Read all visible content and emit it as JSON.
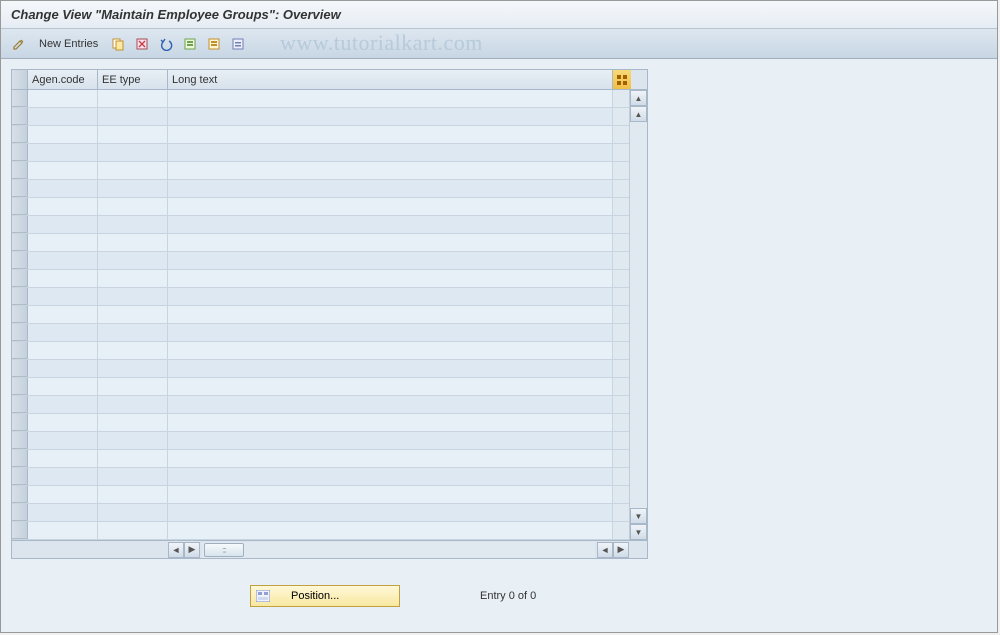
{
  "title": "Change View \"Maintain Employee Groups\": Overview",
  "toolbar": {
    "new_entries": "New Entries"
  },
  "watermark": "www.tutorialkart.com",
  "table": {
    "columns": {
      "agen_code": "Agen.code",
      "ee_type": "EE type",
      "long_text": "Long text"
    },
    "row_count": 25
  },
  "footer": {
    "position_btn": "Position...",
    "entry_status": "Entry 0 of 0"
  }
}
